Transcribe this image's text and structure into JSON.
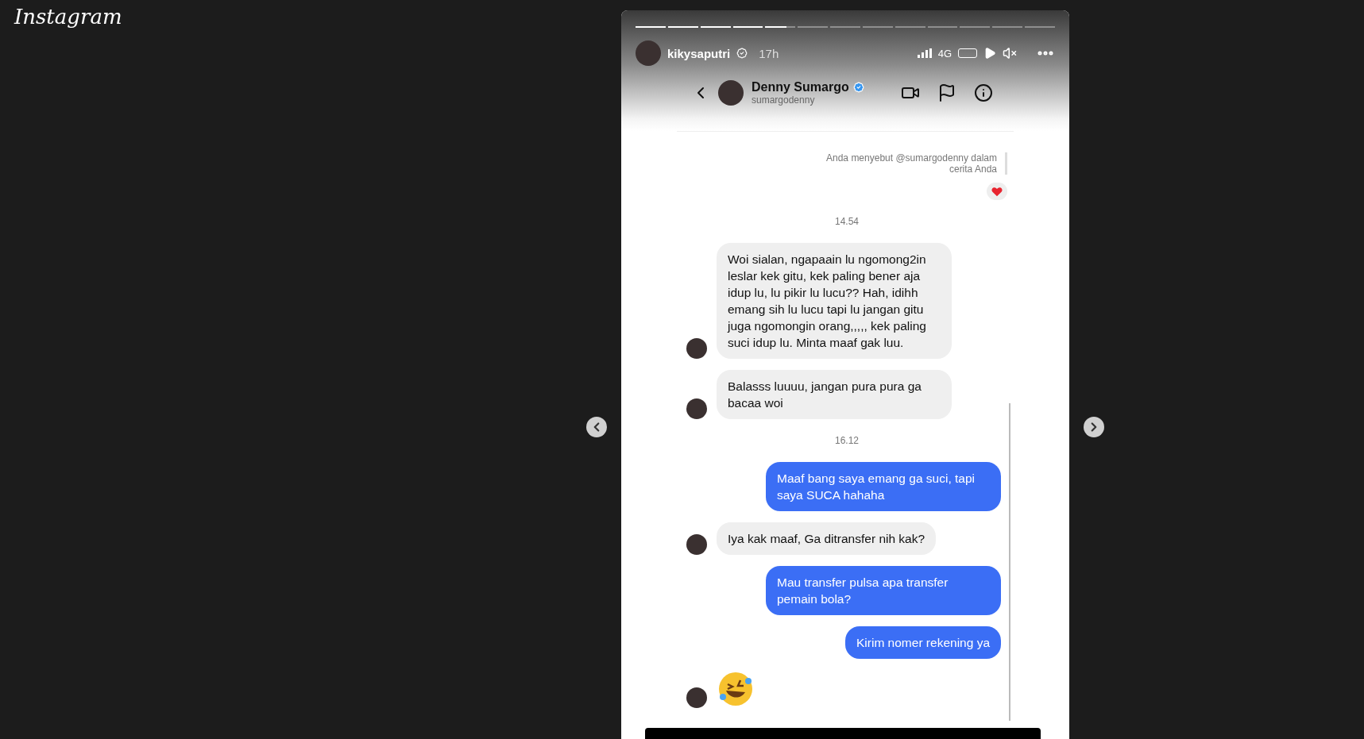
{
  "logo": "Instagram",
  "story": {
    "progress": [
      {
        "seen": true
      },
      {
        "seen": true
      },
      {
        "seen": true
      },
      {
        "seen": true
      },
      {
        "seen": false,
        "level": 0.7
      },
      {
        "seen": false
      },
      {
        "seen": false
      },
      {
        "seen": false
      },
      {
        "seen": false
      },
      {
        "seen": false
      },
      {
        "seen": false
      },
      {
        "seen": false
      },
      {
        "seen": false
      }
    ],
    "username": "kikysaputri",
    "verified": true,
    "age": "17h",
    "network": "4G",
    "muted": true
  },
  "chat": {
    "name": "Denny Sumargo",
    "verified": true,
    "handle": "sumargodenny",
    "messages": [
      {
        "kind": "note",
        "text": "Anda menyebut @sumargodenny dalam cerita Anda"
      },
      {
        "kind": "reaction"
      },
      {
        "kind": "time",
        "text": "14.54"
      },
      {
        "kind": "incoming",
        "text": "Woi sialan, ngapaain lu ngomong2in leslar kek gitu, kek paling bener aja idup lu, lu pikir lu lucu?? Hah, idihh emang sih lu lucu tapi lu jangan gitu juga ngomongin orang,,,,, kek paling suci idup lu. Minta maaf gak luu."
      },
      {
        "kind": "incoming",
        "text": "Balasss luuuu, jangan pura pura ga bacaa woi"
      },
      {
        "kind": "time",
        "text": "16.12"
      },
      {
        "kind": "outgoing",
        "text": "Maaf bang saya emang ga suci, tapi saya SUCA hahaha"
      },
      {
        "kind": "incoming",
        "text": "Iya kak maaf, Ga ditransfer nih kak?"
      },
      {
        "kind": "outgoing",
        "text": "Mau transfer pulsa apa transfer pemain bola?"
      },
      {
        "kind": "outgoing",
        "text": "Kirim nomer rekening ya"
      },
      {
        "kind": "emoji"
      }
    ]
  }
}
